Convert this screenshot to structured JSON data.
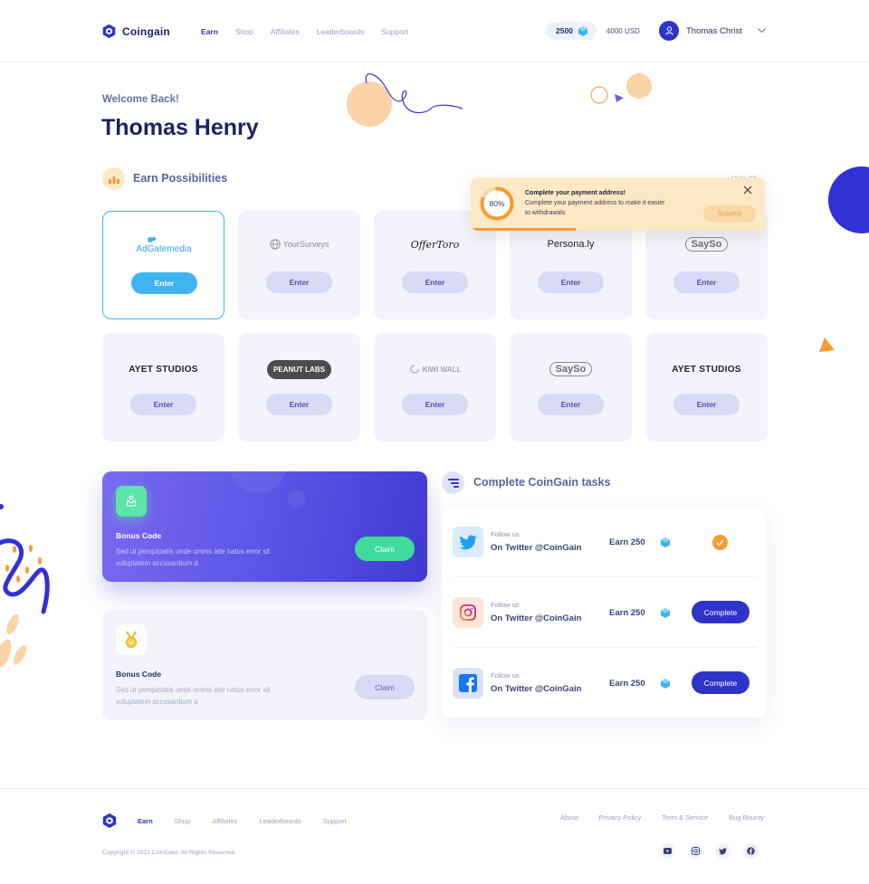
{
  "header": {
    "brand": "Coingain",
    "nav": [
      "Earn",
      "Shop",
      "Affiliates",
      "Leaderboards",
      "Support"
    ],
    "active_nav": "Earn",
    "coins": "2500",
    "usd": "4000 USD",
    "user_name": "Thomas Christ"
  },
  "hero": {
    "welcome": "Welcome Back!",
    "name": "Thomas Henry"
  },
  "earn": {
    "title": "Earn Possibilities",
    "hide_all": "Hide All",
    "offers": [
      {
        "brand": "AdGatemedia",
        "button": "Enter",
        "featured": true
      },
      {
        "brand": "YourSurveys",
        "button": "Enter"
      },
      {
        "brand": "OfferToro",
        "button": "Enter"
      },
      {
        "brand": "Persona.ly",
        "button": "Enter"
      },
      {
        "brand": "SaySo",
        "button": "Enter"
      },
      {
        "brand": "AYET STUDIOS",
        "button": "Enter"
      },
      {
        "brand": "PEANUT LABS",
        "button": "Enter"
      },
      {
        "brand": "KIWI WALL",
        "button": "Enter"
      },
      {
        "brand": "SaySo",
        "button": "Enter"
      },
      {
        "brand": "AYET STUDIOS",
        "button": "Enter"
      }
    ]
  },
  "alert": {
    "percent": "80%",
    "progress": 0.8,
    "title": "Complete your payment address!",
    "body": "Complete your payment address to make it easier to withdrawals",
    "button": "Suggest"
  },
  "bonus": [
    {
      "title": "Bonus Code",
      "desc": "Sed ut perspiciatis unde omnis iste natus error sit voluptatem accusantium d",
      "button": "Claim",
      "icon": "crown-icon"
    },
    {
      "title": "Bonus Code",
      "desc": "Sed ut perspiciatis unde omnis iste natus error sit voluptatem accusantium d",
      "button": "Claim",
      "icon": "medal-icon"
    }
  ],
  "tasks": {
    "title": "Complete CoinGain tasks",
    "items": [
      {
        "follow": "Follow us",
        "handle": "On Twitter @CoinGain",
        "earn": "Earn 250",
        "status": "done",
        "icon": "twitter-icon"
      },
      {
        "follow": "Follow us",
        "handle": "On Twitter @CoinGain",
        "earn": "Earn 250",
        "status": "pending",
        "button": "Complete",
        "icon": "instagram-icon"
      },
      {
        "follow": "Follow us",
        "handle": "On Twitter @CoinGain",
        "earn": "Earn 250",
        "status": "pending",
        "button": "Complete",
        "icon": "facebook-icon"
      }
    ]
  },
  "footer": {
    "nav": [
      "Earn",
      "Shop",
      "Affiliates",
      "Leaderboards",
      "Support"
    ],
    "links": [
      "About",
      "Privacy Policy",
      "Term & Service",
      "Bug Bounty"
    ],
    "copyright": "Copyright © 2021 CoinGain. All Rights Reserved.",
    "social": [
      "youtube-icon",
      "instagram-icon",
      "twitter-icon",
      "facebook-icon"
    ]
  },
  "colors": {
    "primary": "#2f34c9",
    "accent_blue": "#3fb4f1",
    "accent_green": "#3fdc9c",
    "accent_orange": "#f89a36"
  }
}
